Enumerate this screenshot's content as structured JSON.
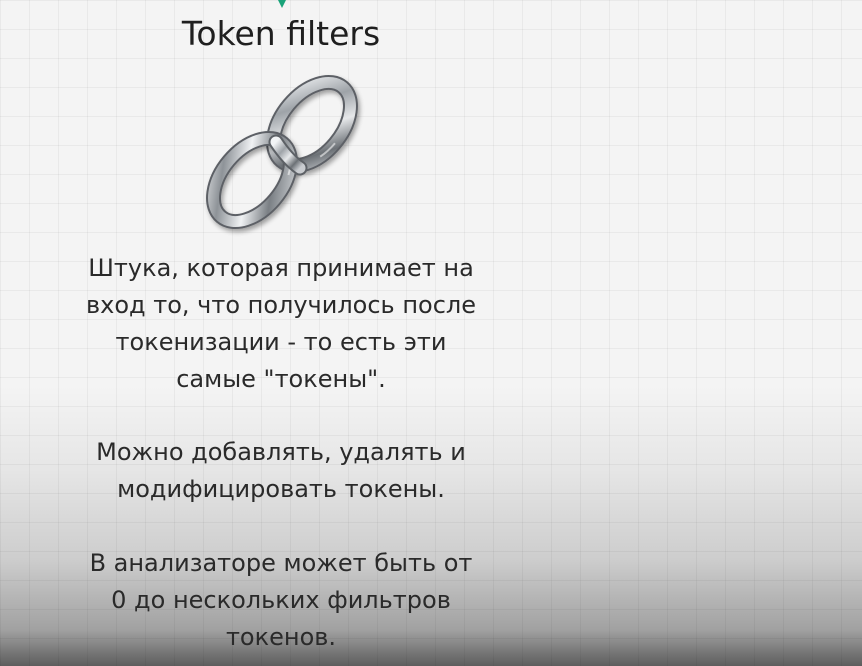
{
  "slide": {
    "title": "Token filters",
    "paragraphs": [
      "Штука, которая принимает на вход то, что получилось после токенизации - то есть эти самые \"токены\".",
      "Можно добавлять, удалять и модифицировать токены.",
      "В анализаторе может быть от 0 до нескольких фильтров токенов."
    ],
    "image_icon": "chain-link-icon"
  },
  "colors": {
    "accent": "#1aa37a",
    "text": "#2a2a2a",
    "background": "#f4f4f4"
  }
}
